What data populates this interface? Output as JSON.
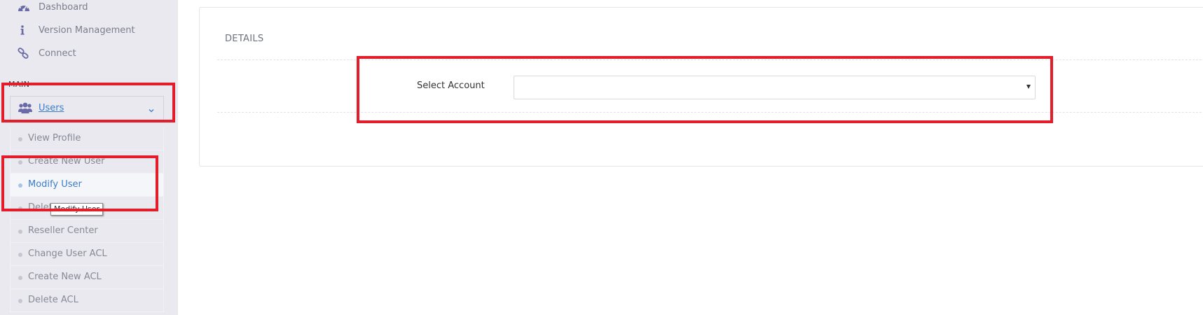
{
  "sidebar": {
    "top_items": [
      {
        "label": "Dashboard",
        "icon": "dashboard-icon"
      },
      {
        "label": "Version Management",
        "icon": "info-icon"
      },
      {
        "label": "Connect",
        "icon": "link-icon"
      }
    ],
    "section_header": "MAIN",
    "users_group": {
      "label": "Users",
      "icon": "users-icon",
      "expanded": true
    },
    "sub_items": [
      {
        "label": "View Profile"
      },
      {
        "label": "Create New User"
      },
      {
        "label": "Modify User",
        "active": true
      },
      {
        "label": "Delete User"
      },
      {
        "label": "Reseller Center"
      },
      {
        "label": "Change User ACL"
      },
      {
        "label": "Create New ACL"
      },
      {
        "label": "Delete ACL"
      }
    ],
    "tooltip": "Modify User"
  },
  "main": {
    "panel_title": "DETAILS",
    "select_label": "Select Account",
    "select_value": ""
  },
  "colors": {
    "sidebar_bg": "#e9e9ef",
    "active_link": "#3d7cc9",
    "icon": "#6a6aa8",
    "highlight": "#e31e2a"
  }
}
